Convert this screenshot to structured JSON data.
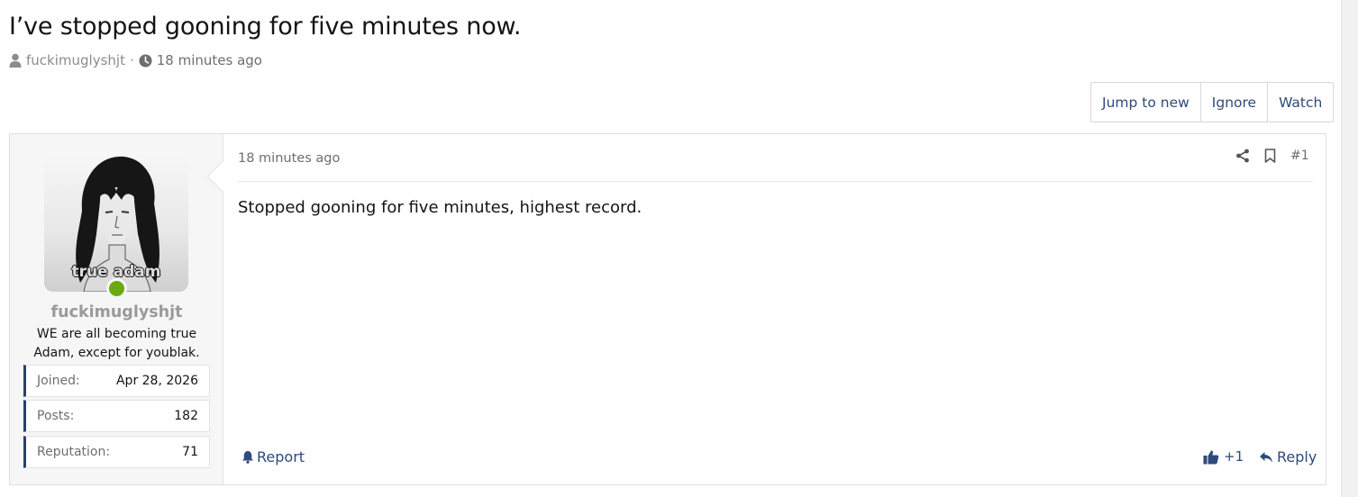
{
  "thread": {
    "title": "I’ve stopped gooning for five minutes now.",
    "author": "fuckimuglyshjt",
    "separator": "·",
    "time": "18 minutes ago"
  },
  "thread_buttons": {
    "jump_to_new": "Jump to new",
    "ignore": "Ignore",
    "watch": "Watch"
  },
  "post": {
    "time": "18 minutes ago",
    "number": "#1",
    "body": "Stopped gooning for five minutes, highest record.",
    "report_label": "Report",
    "reaction_count": "+1",
    "reply_label": "Reply"
  },
  "user": {
    "avatar_caption": "true adam",
    "name": "fuckimuglyshjt",
    "title": "WE are all becoming true Adam, except for youblak.",
    "online": true,
    "stats": [
      {
        "label": "Joined:",
        "value": "Apr 28, 2026"
      },
      {
        "label": "Posts:",
        "value": "182"
      },
      {
        "label": "Reputation:",
        "value": "71"
      }
    ]
  },
  "colors": {
    "link": "#2f4a7d",
    "online": "#6aaa0e",
    "stat_accent": "#2a3f6c",
    "muted": "#8c8c8c"
  },
  "icons": [
    "user-icon",
    "clock-icon",
    "share-icon",
    "bookmark-icon",
    "bell-icon",
    "thumbs-up-icon",
    "reply-icon"
  ]
}
